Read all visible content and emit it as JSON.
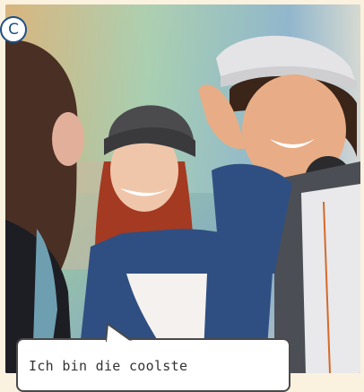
{
  "badge": {
    "label": "C"
  },
  "bubble": {
    "text": "Ich bin die coolste"
  },
  "photo": {
    "alt": ""
  }
}
